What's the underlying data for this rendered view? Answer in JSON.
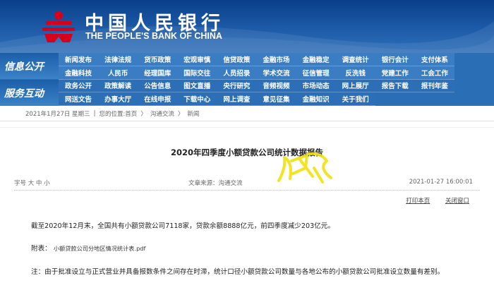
{
  "header": {
    "logo_cn": "中国人民银行",
    "logo_en": "THE PEOPLE'S BANK OF CHINA"
  },
  "nav": {
    "section1": "信息公开",
    "section2": "服务互动",
    "rows": [
      [
        "新闻发布",
        "法律法规",
        "货币政策",
        "宏观审慎",
        "信贷政策",
        "金融市场",
        "金融稳定",
        "调查统计",
        "银行会计",
        "支付体系",
        ""
      ],
      [
        "金融科技",
        "人民币",
        "经理国库",
        "国际交往",
        "人员招录",
        "学术交流",
        "征信管理",
        "反洗钱",
        "党建工作",
        "工会工作",
        ""
      ],
      [
        "政务公开",
        "政策解读",
        "公告信息",
        "图文直播",
        "央行研究",
        "音频视频",
        "市场动态",
        "网上展厅",
        "报告下载",
        "报刊年鉴",
        ""
      ],
      [
        "网送文告",
        "办事大厅",
        "在线申报",
        "下载中心",
        "网上调查",
        "意见征集",
        "金融知识",
        "关于我们",
        "",
        "",
        ""
      ]
    ]
  },
  "breadcrumb": {
    "date": "2021年1月27日 星期三",
    "location_prefix": "您的位置:首页",
    "sep1": "〉",
    "level1": "沟通交流",
    "sep2": "〉",
    "level2": "新闻"
  },
  "article": {
    "title": "2020年四季度小额贷款公司统计数据报告",
    "font_size_label": "字号 大 中 小",
    "source": "文章来源：沟通交流",
    "datetime": "2021-01-27 16:00:01",
    "print_label": "打印本页",
    "close_label": "关闭窗口",
    "paragraph1": "截至2020年12月末，全国共有小额贷款公司7118家，贷款余额8888亿元，前四季度减少203亿元。",
    "attachment_label": "附表：",
    "attachment_file": "小额贷款公司分地区情况统计表.pdf",
    "note": "注：由于批准设立与正式营业并具备报数条件之间存在时滞，统计口径小额贷款公司数量与各地公布的小额贷款公司批准设立数量有差别。"
  },
  "colors": {
    "header_blue": "#1d5ba8",
    "nav_blue": "#3a7dc3",
    "logo_red": "#d6001c"
  }
}
